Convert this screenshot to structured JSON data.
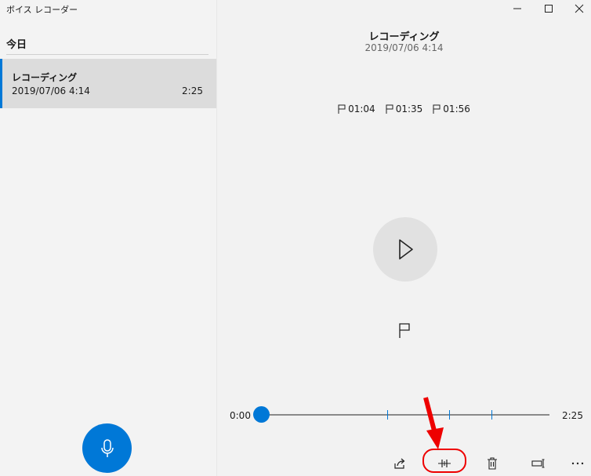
{
  "app": {
    "title": "ボイス レコーダー"
  },
  "sidebar": {
    "section_header": "今日",
    "recordings": [
      {
        "name": "レコーディング",
        "date": "2019/07/06 4:14",
        "duration": "2:25"
      }
    ],
    "record_icon": "microphone-icon"
  },
  "window_controls": [
    "minimize-icon",
    "maximize-icon",
    "close-icon"
  ],
  "player": {
    "title": "レコーディング",
    "date": "2019/07/06 4:14",
    "markers": [
      "01:04",
      "01:35",
      "01:56"
    ],
    "current_time": "0:00",
    "total_time": "2:25",
    "progress": 0.0,
    "marker_fractions": [
      0.441,
      0.655,
      0.8
    ]
  },
  "toolbar": [
    "share-icon",
    "trim-icon",
    "delete-icon",
    "rename-icon",
    "more-icon"
  ],
  "colors": {
    "accent": "#0078d7",
    "annotation": "#e00000"
  }
}
